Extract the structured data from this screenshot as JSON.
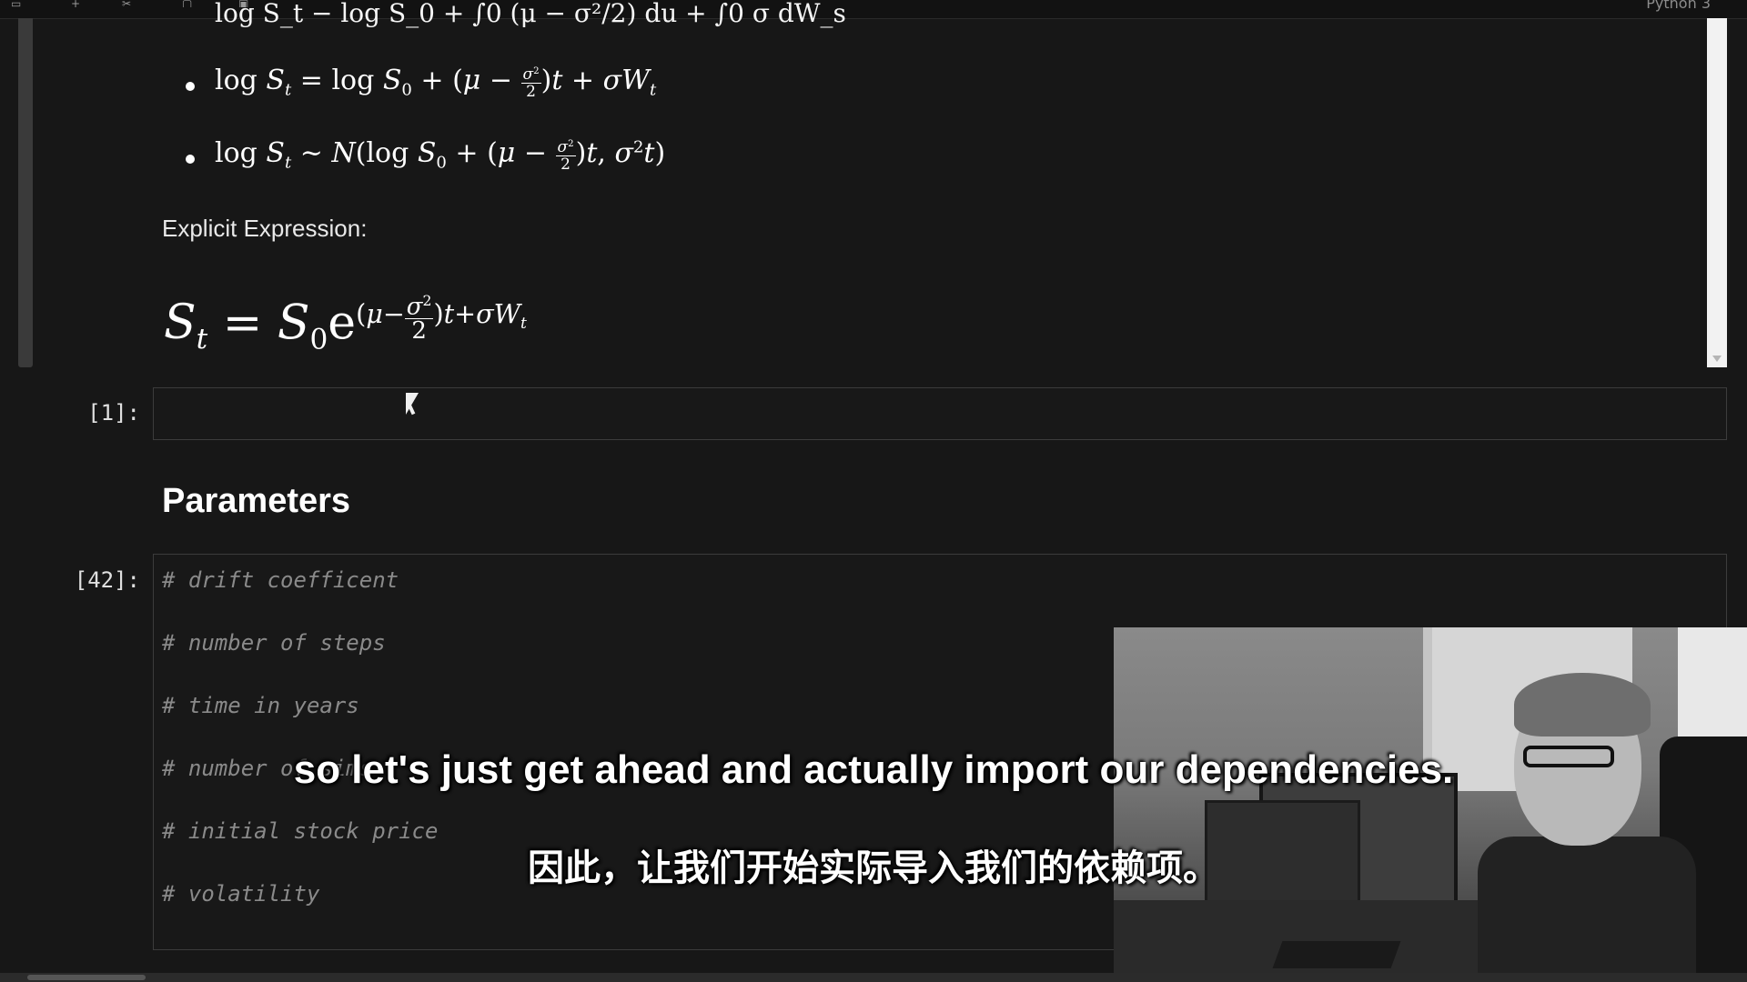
{
  "toolbar": {
    "kernel_label": "Python 3"
  },
  "markdown_cell": {
    "partial_top_line": "log S_t − log S_0 + ∫0 (μ − σ²/2) du + ∫0 σ dW_s",
    "bullet_1": {
      "lhs": "log",
      "rhs_a": "log",
      "sigma_sq": "σ2",
      "two": "2"
    },
    "bullet_2": {
      "prefix": "log",
      "sim": "∼",
      "N": "N",
      "inner": "log"
    },
    "explicit_label": "Explicit Expression:"
  },
  "cells": [
    {
      "prompt": "[1]:",
      "content": ""
    },
    {
      "prompt": "[42]:",
      "lines": [
        "# drift coefficent",
        "# number of steps",
        "# time in years",
        "# number of sims",
        "# initial stock price",
        "# volatility"
      ]
    }
  ],
  "section_heading": "Parameters",
  "subtitles": {
    "english": "so let's just get ahead and actually import our dependencies.",
    "chinese": "因此，让我们开始实际导入我们的依赖项。"
  },
  "colors": {
    "background": "#171717",
    "comment": "#8a8a8a",
    "prompt": "#e0e0e0"
  },
  "icons": [
    "save-icon",
    "add-icon",
    "cut-icon",
    "copy-icon",
    "paste-icon",
    "mouse-cursor-icon"
  ]
}
